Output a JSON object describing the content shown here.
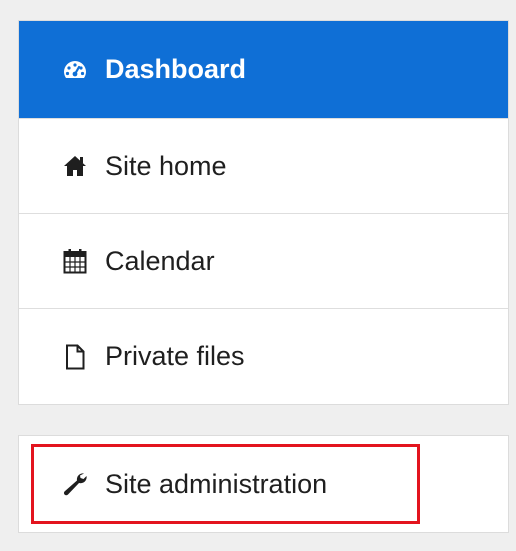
{
  "nav": {
    "items": [
      {
        "label": "Dashboard",
        "icon": "tachometer-icon",
        "active": true
      },
      {
        "label": "Site home",
        "icon": "home-icon",
        "active": false
      },
      {
        "label": "Calendar",
        "icon": "calendar-icon",
        "active": false
      },
      {
        "label": "Private files",
        "icon": "file-icon",
        "active": false
      }
    ]
  },
  "admin": {
    "label": "Site administration",
    "icon": "wrench-icon"
  },
  "colors": {
    "active_bg": "#0f6fd6",
    "highlight_border": "#e3141e"
  }
}
